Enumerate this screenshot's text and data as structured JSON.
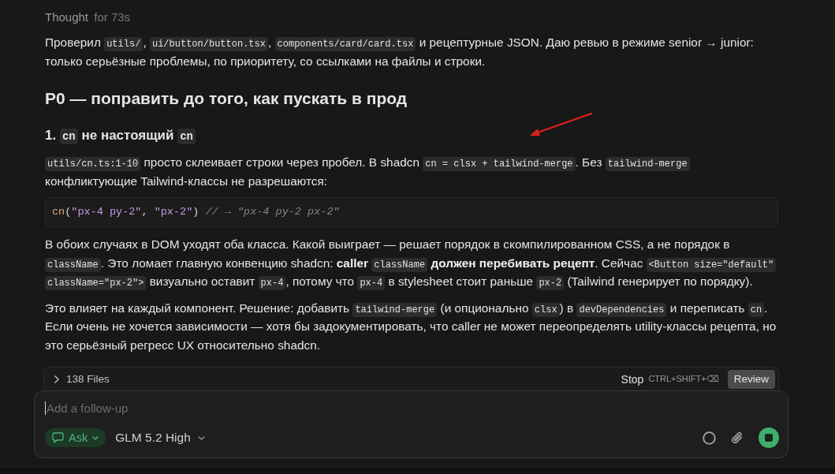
{
  "thought": {
    "label": "Thought",
    "duration": "for 73s"
  },
  "message": [
    {
      "kind": "paragraph",
      "segments": [
        {
          "kind": "text",
          "text": "Проверил "
        },
        {
          "kind": "code",
          "text": "utils/"
        },
        {
          "kind": "text",
          "text": ", "
        },
        {
          "kind": "code",
          "text": "ui/button/button.tsx"
        },
        {
          "kind": "text",
          "text": ", "
        },
        {
          "kind": "code",
          "text": "components/card/card.tsx"
        },
        {
          "kind": "text",
          "text": " и рецептурные JSON. Даю ревью в режиме senior → junior: только серьёзные проблемы, по приоритету, со ссылками на файлы и строки."
        }
      ]
    },
    {
      "kind": "heading2",
      "segments": [
        {
          "kind": "text",
          "text": "P0 — поправить до того, как пускать в прод"
        }
      ]
    },
    {
      "kind": "heading3",
      "segments": [
        {
          "kind": "text",
          "text": "1. "
        },
        {
          "kind": "code",
          "text": "cn"
        },
        {
          "kind": "text",
          "text": " не настоящий "
        },
        {
          "kind": "code",
          "text": "cn"
        }
      ]
    },
    {
      "kind": "paragraph",
      "segments": [
        {
          "kind": "code",
          "text": "utils/cn.ts:1-10"
        },
        {
          "kind": "text",
          "text": " просто склеивает строки через пробел. В shadcn "
        },
        {
          "kind": "code",
          "text": "cn = clsx + tailwind-merge"
        },
        {
          "kind": "text",
          "text": ". Без "
        },
        {
          "kind": "code",
          "text": "tailwind-merge"
        },
        {
          "kind": "text",
          "text": " конфликтующие Tailwind-классы не разрешаются:"
        }
      ]
    },
    {
      "kind": "code_block",
      "tokens": [
        {
          "kind": "fn",
          "text": "cn"
        },
        {
          "kind": "punct",
          "text": "("
        },
        {
          "kind": "string",
          "text": "\"px-4 py-2\""
        },
        {
          "kind": "punct",
          "text": ", "
        },
        {
          "kind": "string",
          "text": "\"px-2\""
        },
        {
          "kind": "punct",
          "text": ") "
        },
        {
          "kind": "comment",
          "text": "// → \"px-4 py-2 px-2\""
        }
      ]
    },
    {
      "kind": "paragraph",
      "segments": [
        {
          "kind": "text",
          "text": "В обоих случаях в DOM уходят оба класса. Какой выиграет — решает порядок в скомпилированном CSS, а не порядок в "
        },
        {
          "kind": "code",
          "text": "className"
        },
        {
          "kind": "text",
          "text": ". Это ломает главную конвенцию shadcn: "
        },
        {
          "kind": "bold",
          "text": "caller "
        },
        {
          "kind": "code",
          "text": "className"
        },
        {
          "kind": "bold",
          "text": " должен перебивать рецепт"
        },
        {
          "kind": "text",
          "text": ". Сейчас "
        },
        {
          "kind": "code",
          "text": "<Button size=\"default\" className=\"px-2\">"
        },
        {
          "kind": "text",
          "text": " визуально оставит "
        },
        {
          "kind": "code",
          "text": "px-4"
        },
        {
          "kind": "text",
          "text": ", потому что "
        },
        {
          "kind": "code",
          "text": "px-4"
        },
        {
          "kind": "text",
          "text": " в stylesheet стоит раньше "
        },
        {
          "kind": "code",
          "text": "px-2"
        },
        {
          "kind": "text",
          "text": " (Tailwind генерирует по порядку)."
        }
      ]
    },
    {
      "kind": "paragraph",
      "segments": [
        {
          "kind": "text",
          "text": "Это влияет на каждый компонент. Решение: добавить "
        },
        {
          "kind": "code",
          "text": "tailwind-merge"
        },
        {
          "kind": "text",
          "text": " (и опционально "
        },
        {
          "kind": "code",
          "text": "clsx"
        },
        {
          "kind": "text",
          "text": ") в "
        },
        {
          "kind": "code",
          "text": "devDependencies"
        },
        {
          "kind": "text",
          "text": " и переписать "
        },
        {
          "kind": "code",
          "text": "cn"
        },
        {
          "kind": "text",
          "text": ". Если очень не хочется зависимости — хотя бы задокументировать, что caller не может переопределять utility-классы рецепта, но это серьёзный регресс UX относительно shadcn."
        }
      ]
    }
  ],
  "files_bar": {
    "label": "138 Files",
    "expanded": false,
    "stop_label": "Stop",
    "stop_shortcut": "CTRL+SHIFT+⌫",
    "review_label": "Review"
  },
  "composer": {
    "placeholder": "Add a follow-up",
    "mode": "Ask",
    "model": "GLM 5.2 High"
  }
}
